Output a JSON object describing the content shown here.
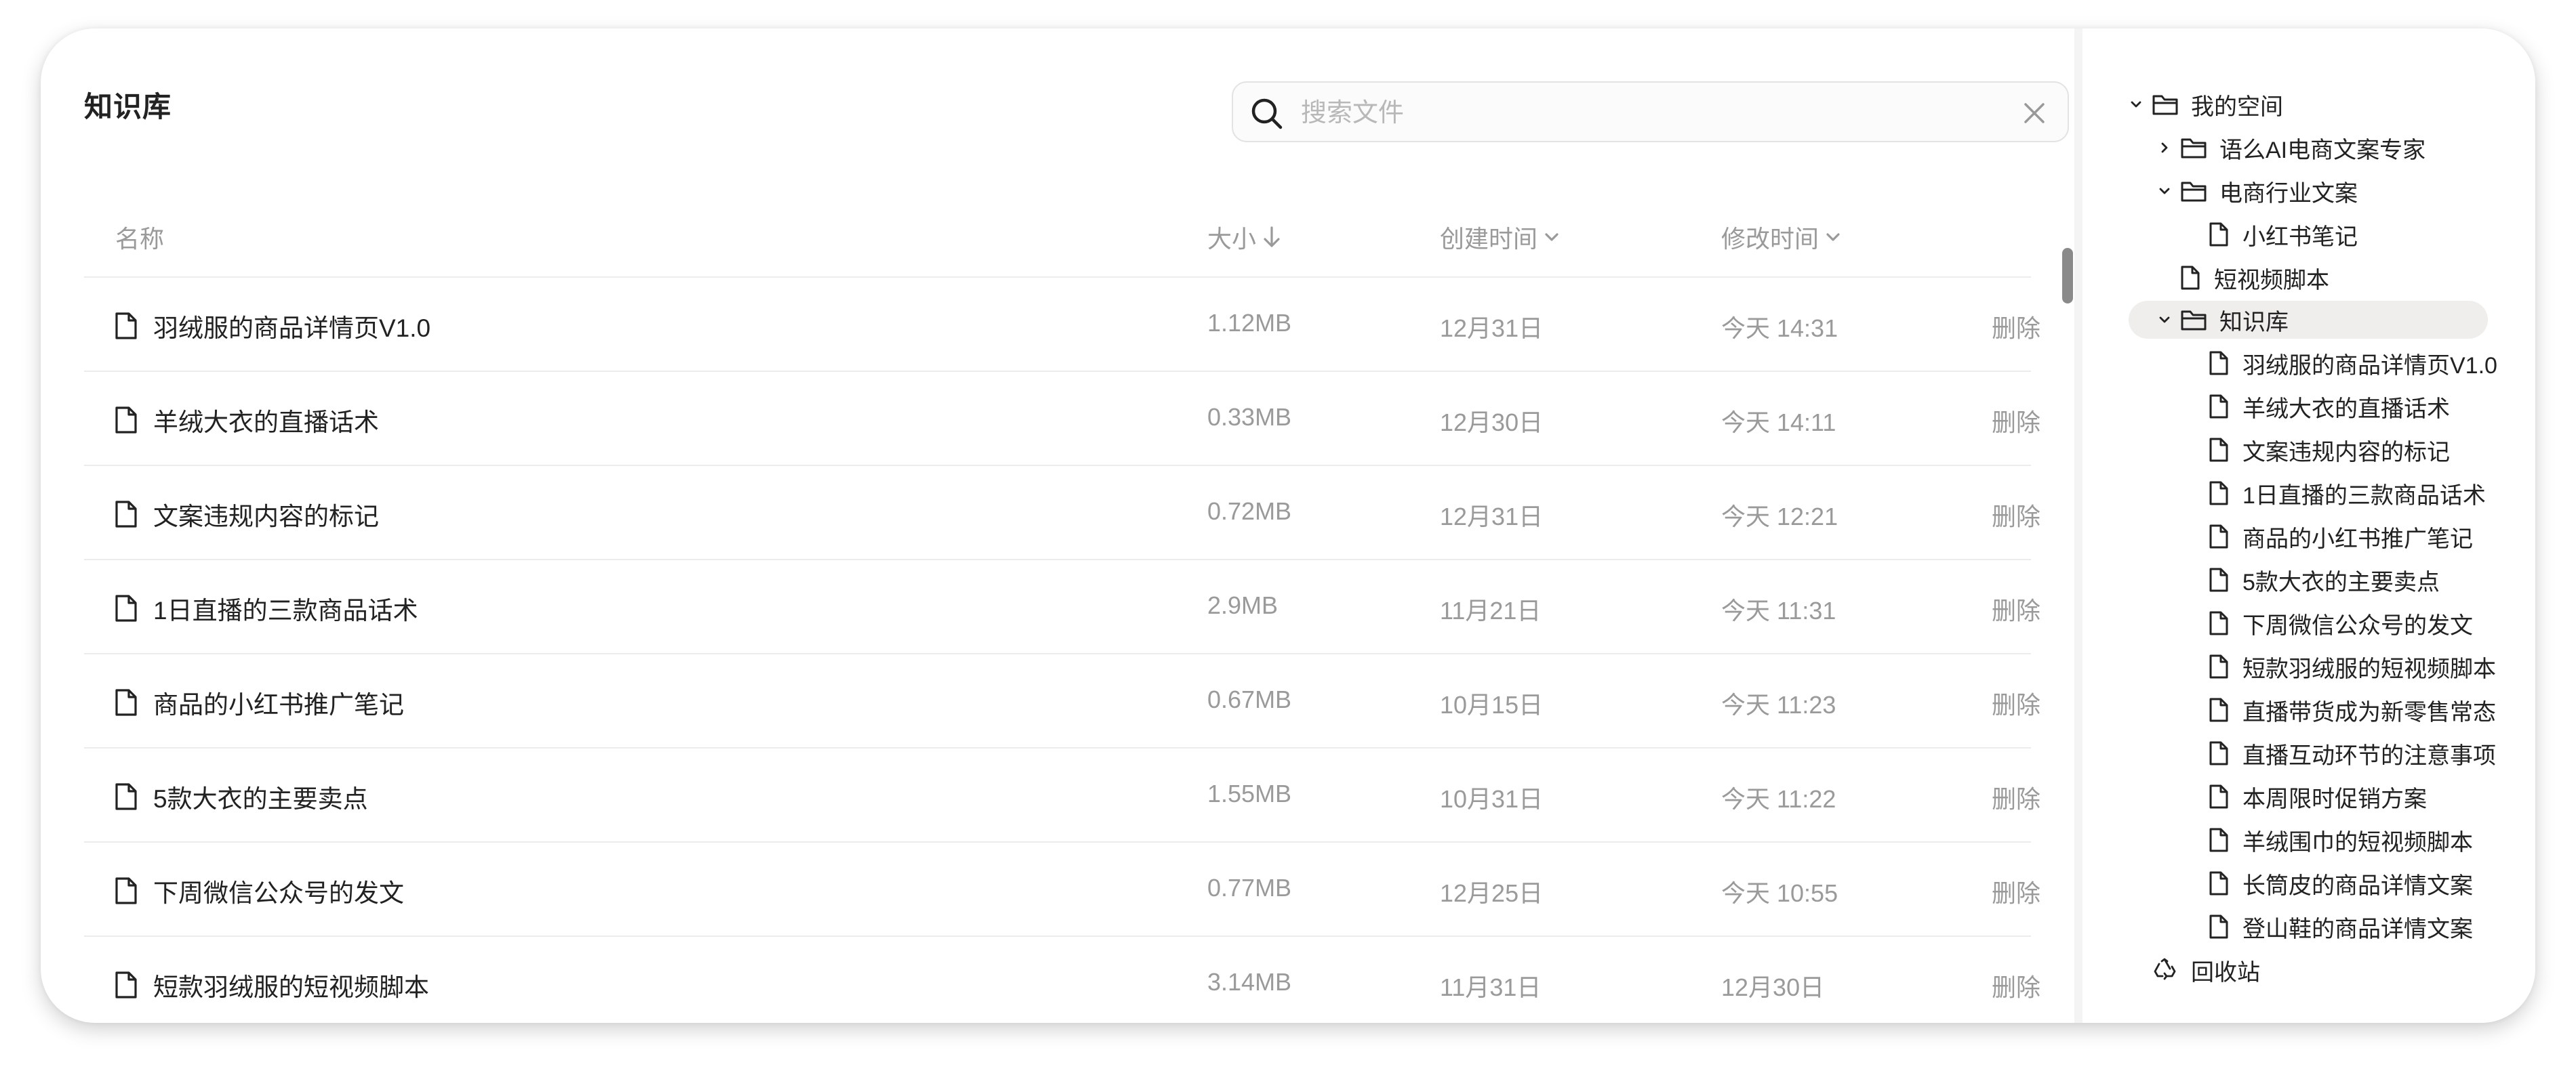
{
  "header": {
    "title": "知识库"
  },
  "search": {
    "placeholder": "搜索文件"
  },
  "table": {
    "columns": {
      "name": "名称",
      "size": "大小",
      "created": "创建时间",
      "modified": "修改时间"
    },
    "rows": [
      {
        "name": "羽绒服的商品详情页V1.0",
        "size": "1.12MB",
        "created": "12月31日",
        "modified": "今天 14:31",
        "action": "删除"
      },
      {
        "name": "羊绒大衣的直播话术",
        "size": "0.33MB",
        "created": "12月30日",
        "modified": "今天 14:11",
        "action": "删除"
      },
      {
        "name": "文案违规内容的标记",
        "size": "0.72MB",
        "created": "12月31日",
        "modified": "今天 12:21",
        "action": "删除"
      },
      {
        "name": "1日直播的三款商品话术",
        "size": "2.9MB",
        "created": "11月21日",
        "modified": "今天 11:31",
        "action": "删除"
      },
      {
        "name": "商品的小红书推广笔记",
        "size": "0.67MB",
        "created": "10月15日",
        "modified": "今天 11:23",
        "action": "删除"
      },
      {
        "name": "5款大衣的主要卖点",
        "size": "1.55MB",
        "created": "10月31日",
        "modified": "今天 11:22",
        "action": "删除"
      },
      {
        "name": "下周微信公众号的发文",
        "size": "0.77MB",
        "created": "12月25日",
        "modified": "今天 10:55",
        "action": "删除"
      },
      {
        "name": "短款羽绒服的短视频脚本",
        "size": "3.14MB",
        "created": "11月31日",
        "modified": "12月30日",
        "action": "删除"
      }
    ]
  },
  "sidebar": {
    "root": "我的空间",
    "folders": [
      {
        "label": "语么AI电商文案专家",
        "expanded": false
      },
      {
        "label": "电商行业文案",
        "expanded": true,
        "children": [
          "小红书笔记"
        ]
      }
    ],
    "loose_file": "短视频脚本",
    "knowledge": {
      "label": "知识库",
      "expanded": true,
      "selected": true,
      "children": [
        "羽绒服的商品详情页V1.0",
        "羊绒大衣的直播话术",
        "文案违规内容的标记",
        "1日直播的三款商品话术",
        "商品的小红书推广笔记",
        "5款大衣的主要卖点",
        "下周微信公众号的发文",
        "短款羽绒服的短视频脚本",
        "直播带货成为新零售常态",
        "直播互动环节的注意事项",
        "本周限时促销方案",
        "羊绒围巾的短视频脚本",
        "长筒皮的商品详情文案",
        "登山鞋的商品详情文案"
      ]
    },
    "recycle": "回收站"
  },
  "colors": {
    "text": "#222222",
    "muted": "#9a9a9a",
    "divider": "#ececec",
    "selected_bg": "#efeeec"
  }
}
